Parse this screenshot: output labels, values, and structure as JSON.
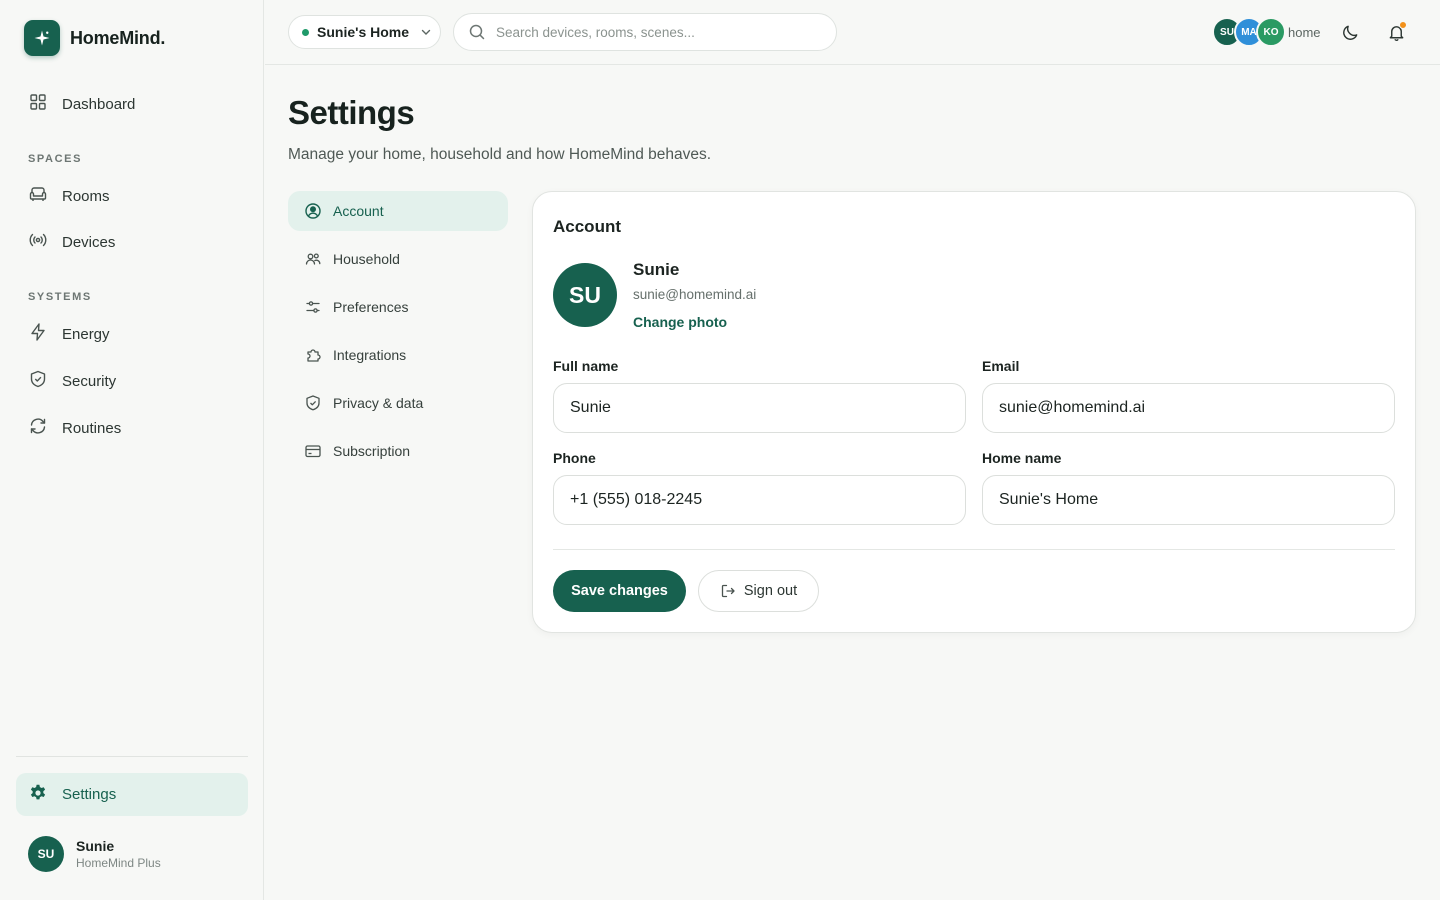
{
  "brand": {
    "name": "HomeMind.",
    "logo_icon": "sparkle-icon"
  },
  "colors": {
    "accent": "#17614f",
    "accent_soft": "#e3f1ec",
    "notification": "#f2911b"
  },
  "sidebar": {
    "dashboard": "Dashboard",
    "sections": {
      "spaces": "SPACES",
      "systems": "SYSTEMS"
    },
    "items": [
      {
        "label": "Dashboard",
        "icon": "grid-icon"
      },
      {
        "label": "Rooms",
        "icon": "sofa-icon"
      },
      {
        "label": "Devices",
        "icon": "broadcast-icon"
      },
      {
        "label": "Energy",
        "icon": "bolt-icon"
      },
      {
        "label": "Security",
        "icon": "shield-icon"
      },
      {
        "label": "Routines",
        "icon": "refresh-icon"
      }
    ],
    "settings": {
      "label": "Settings",
      "icon": "gear-icon"
    },
    "user": {
      "initials": "SU",
      "name": "Sunie",
      "plan": "HomeMind Plus"
    }
  },
  "topbar": {
    "home_switch": "Sunie's Home",
    "search_placeholder": "Search devices, rooms, scenes...",
    "members": [
      {
        "initials": "SU",
        "color": "#17614f"
      },
      {
        "initials": "MA",
        "color": "#2f8fd9"
      },
      {
        "initials": "KO",
        "color": "#2a9a63"
      }
    ],
    "members_label": "home"
  },
  "page": {
    "title": "Settings",
    "subtitle": "Manage your home, household and how HomeMind behaves."
  },
  "settings_nav": [
    {
      "label": "Account",
      "icon": "user-circle-icon",
      "active": true
    },
    {
      "label": "Household",
      "icon": "users-icon"
    },
    {
      "label": "Preferences",
      "icon": "sliders-icon"
    },
    {
      "label": "Integrations",
      "icon": "puzzle-icon"
    },
    {
      "label": "Privacy & data",
      "icon": "shield-check-icon"
    },
    {
      "label": "Subscription",
      "icon": "credit-card-icon"
    }
  ],
  "account": {
    "title": "Account",
    "initials": "SU",
    "name": "Sunie",
    "email": "sunie@homemind.ai",
    "change_photo": "Change photo",
    "fields": {
      "full_name": {
        "label": "Full name",
        "value": "Sunie"
      },
      "email": {
        "label": "Email",
        "value": "sunie@homemind.ai"
      },
      "phone": {
        "label": "Phone",
        "value": "+1 (555) 018-2245"
      },
      "home_name": {
        "label": "Home name",
        "value": "Sunie's Home"
      }
    },
    "save_label": "Save changes",
    "signout_label": "Sign out"
  }
}
